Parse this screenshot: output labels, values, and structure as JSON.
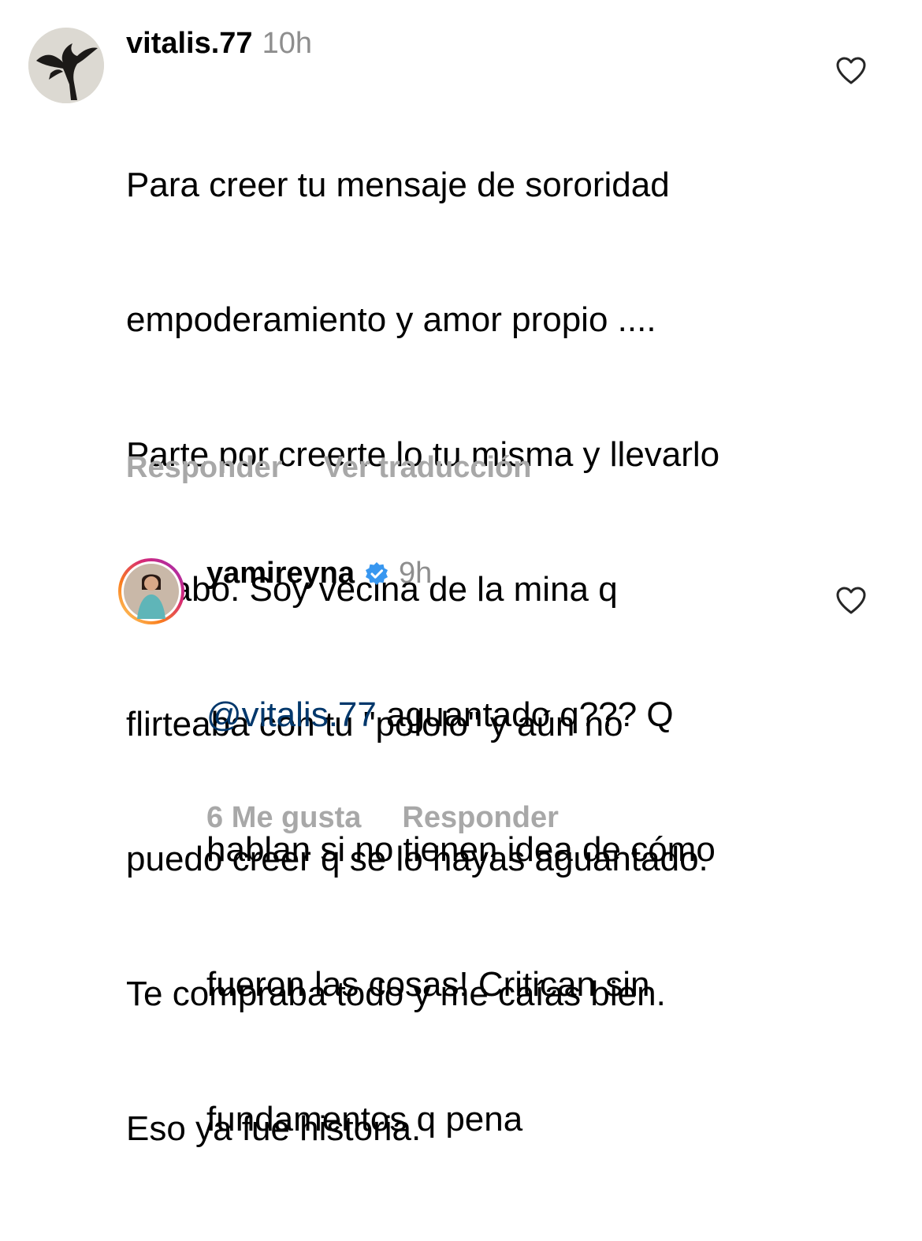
{
  "comments": [
    {
      "username": "vitalis.77",
      "time": "10h",
      "lines": [
        "Para creer tu mensaje de sororidad",
        "empoderamiento y amor propio ....",
        "Parte por creerte lo tu misma y llevarlo",
        "a cabo. Soy vecina de la mina q",
        "flirteaba con tu \"pololo\" y aún no",
        "puedo creer q se lo hayas aguantado.",
        "Te compraba todo y me caías bien.",
        "Eso ya fue historia."
      ],
      "reply_label": "Responder",
      "translate_label": "Ver traducción",
      "avatar_icon": "bird-silhouette-avatar",
      "like_icon": "heart-outline-icon"
    },
    {
      "username": "yamireyna",
      "verified": true,
      "time": "9h",
      "mention": "@vitalis.77",
      "lines": [
        " aguantado q??? Q",
        "hablan si no tienen idea de cómo",
        "fueron las cosas! Critican sin",
        "fundamentos q pena"
      ],
      "likes_label": "6 Me gusta",
      "reply_label": "Responder",
      "avatar_icon": "profile-photo-avatar",
      "like_icon": "heart-outline-icon"
    }
  ],
  "colors": {
    "text": "#000000",
    "secondary": "#8e8e8e",
    "action": "#a8a8a8",
    "mention": "#00376b",
    "verified": "#3897f0"
  }
}
